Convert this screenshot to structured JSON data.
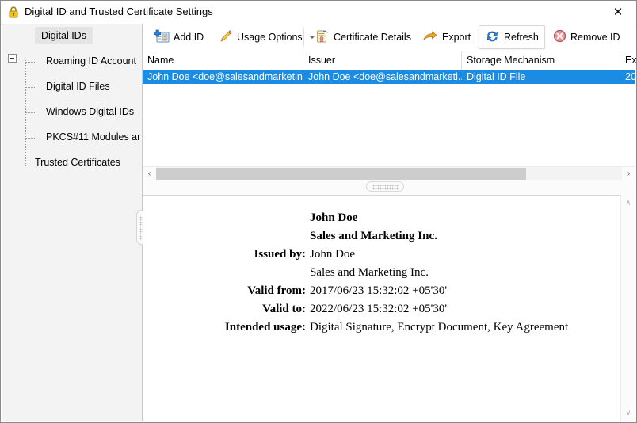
{
  "window": {
    "title": "Digital ID and Trusted Certificate Settings",
    "lock_icon": "lock-icon",
    "close_label": "✕"
  },
  "sidebar": {
    "items": [
      {
        "label": "Digital IDs",
        "level": 0,
        "selected": true,
        "expander": "minus"
      },
      {
        "label": "Roaming ID Account",
        "level": 1,
        "selected": false
      },
      {
        "label": "Digital ID Files",
        "level": 1,
        "selected": false
      },
      {
        "label": "Windows Digital IDs",
        "level": 1,
        "selected": false
      },
      {
        "label": "PKCS#11 Modules ar",
        "level": 1,
        "selected": false
      },
      {
        "label": "Trusted Certificates",
        "level": 0,
        "selected": false
      }
    ]
  },
  "toolbar": {
    "buttons": [
      {
        "label": "Add ID",
        "icon": "add-id-card-icon",
        "hover": false,
        "dropdown": false
      },
      {
        "label": "Usage Options",
        "icon": "pencil-icon",
        "hover": false,
        "dropdown": true
      },
      {
        "label": "Certificate Details",
        "icon": "certificate-icon",
        "hover": false,
        "dropdown": false
      },
      {
        "label": "Export",
        "icon": "export-arrow-icon",
        "hover": false,
        "dropdown": false
      },
      {
        "label": "Refresh",
        "icon": "refresh-icon",
        "hover": true,
        "dropdown": false
      },
      {
        "label": "Remove ID",
        "icon": "remove-circle-x-icon",
        "hover": false,
        "dropdown": false
      }
    ]
  },
  "list": {
    "columns": [
      "Name",
      "Issuer",
      "Storage Mechanism",
      "Ex"
    ],
    "rows": [
      {
        "selected": true,
        "cells": [
          "John Doe <doe@salesandmarketin...",
          "John Doe <doe@salesandmarketi...",
          "Digital ID File",
          "20"
        ]
      }
    ]
  },
  "detail": {
    "lines": [
      {
        "label": "",
        "value": "John Doe",
        "bold_value": true
      },
      {
        "label": "",
        "value": "Sales and Marketing Inc.",
        "bold_value": true
      },
      {
        "label": "Issued by:",
        "value": "John Doe",
        "bold_value": false
      },
      {
        "label": "",
        "value": "Sales and Marketing Inc.",
        "bold_value": false
      },
      {
        "label": "Valid from:",
        "value": "2017/06/23 15:32:02 +05'30'",
        "bold_value": false
      },
      {
        "label": "Valid to:",
        "value": "2022/06/23 15:32:02 +05'30'",
        "bold_value": false
      },
      {
        "label": "Intended usage:",
        "value": "Digital Signature, Encrypt Document, Key Agreement",
        "bold_value": false
      }
    ]
  },
  "scrollbars": {
    "h_left_arrow": "‹",
    "h_right_arrow": "›",
    "v_up_arrow": "∧",
    "v_down_arrow": "∨"
  },
  "colors": {
    "selection_blue": "#1b8ce3",
    "sidebar_bg": "#f3f3f3",
    "window_border": "#8a8a8a"
  }
}
